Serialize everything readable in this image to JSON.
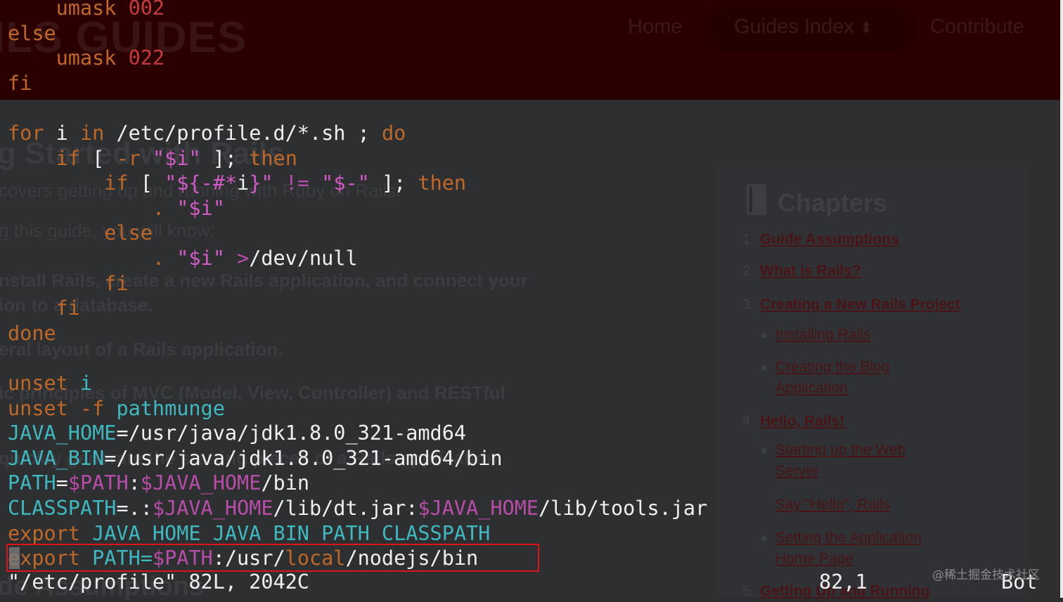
{
  "background_page": {
    "logo_text": "ILS GUIDES",
    "nav": {
      "home": "Home",
      "guides_index": "Guides Index",
      "contribute": "Contribute"
    },
    "hero": {
      "title": "g Started with Rails",
      "line1": "covers getting up and running with Ruby on Rails.",
      "line2": "g this guide, you will know:",
      "line3": "nstall Rails, create a new Rails application, and connect your",
      "line4": "ion to a database.",
      "line5": "eral layout of a Rails application.",
      "line6": "ic principles of MVC (Model, View, Controller) and RESTful",
      "line7": "quickly generate the starting pieces of a Rails application.",
      "footer_heading": "de Assumptions"
    },
    "sidebar": {
      "heading": "Chapters",
      "items": [
        {
          "num": "1.",
          "label": "Guide Assumptions"
        },
        {
          "num": "2.",
          "label": "What is Rails?"
        },
        {
          "num": "3.",
          "label": "Creating a New Rails Project"
        },
        {
          "num": "",
          "label": "Installing Rails"
        },
        {
          "num": "",
          "label": "Creating the Blog"
        },
        {
          "num": "",
          "label": "Application"
        },
        {
          "num": "4.",
          "label": "Hello, Rails!"
        },
        {
          "num": "",
          "label": "Starting up the Web"
        },
        {
          "num": "",
          "label": "Server"
        },
        {
          "num": "",
          "label": "Say \"Hello\", Rails"
        },
        {
          "num": "",
          "label": "Setting the Application"
        },
        {
          "num": "",
          "label": "Home Page"
        },
        {
          "num": "5.",
          "label": "Getting Up and Running"
        }
      ]
    }
  },
  "terminal": {
    "lines": [
      [
        {
          "t": "    umask ",
          "c": "kw"
        },
        {
          "t": "002",
          "c": "num"
        }
      ],
      [
        {
          "t": "else",
          "c": "kw"
        }
      ],
      [
        {
          "t": "    umask ",
          "c": "kw"
        },
        {
          "t": "022",
          "c": "num"
        }
      ],
      [
        {
          "t": "fi",
          "c": "kw"
        }
      ],
      [],
      [
        {
          "t": "for",
          "c": "kw"
        },
        {
          "t": " i ",
          "c": "pl"
        },
        {
          "t": "in",
          "c": "kw"
        },
        {
          "t": " /etc/profile.d/*.sh ; ",
          "c": "pl"
        },
        {
          "t": "do",
          "c": "kw"
        }
      ],
      [
        {
          "t": "    if",
          "c": "kw"
        },
        {
          "t": " [ ",
          "c": "pl"
        },
        {
          "t": "-r",
          "c": "kw"
        },
        {
          "t": " ",
          "c": "pl"
        },
        {
          "t": "\"$i\"",
          "c": "str"
        },
        {
          "t": " ]; ",
          "c": "pl"
        },
        {
          "t": "then",
          "c": "kw"
        }
      ],
      [
        {
          "t": "        if",
          "c": "kw"
        },
        {
          "t": " [ ",
          "c": "pl"
        },
        {
          "t": "\"${-#*",
          "c": "str"
        },
        {
          "t": "i",
          "c": "pl"
        },
        {
          "t": "}\"",
          "c": "str"
        },
        {
          "t": " != ",
          "c": "sp"
        },
        {
          "t": "\"$-\"",
          "c": "str"
        },
        {
          "t": " ]; ",
          "c": "pl"
        },
        {
          "t": "then",
          "c": "kw"
        }
      ],
      [
        {
          "t": "            . ",
          "c": "kw"
        },
        {
          "t": "\"$i\"",
          "c": "str"
        }
      ],
      [
        {
          "t": "        else",
          "c": "kw"
        }
      ],
      [
        {
          "t": "            . ",
          "c": "kw"
        },
        {
          "t": "\"$i\"",
          "c": "str"
        },
        {
          "t": " >",
          "c": "sp"
        },
        {
          "t": "/dev/null",
          "c": "pl"
        }
      ],
      [
        {
          "t": "        fi",
          "c": "kw"
        }
      ],
      [
        {
          "t": "    fi",
          "c": "kw"
        }
      ],
      [
        {
          "t": "done",
          "c": "kw"
        }
      ],
      [],
      [
        {
          "t": "unset",
          "c": "kw"
        },
        {
          "t": " i",
          "c": "var"
        }
      ],
      [
        {
          "t": "unset",
          "c": "kw"
        },
        {
          "t": " -f ",
          "c": "kw"
        },
        {
          "t": "pathmunge",
          "c": "var"
        }
      ],
      [
        {
          "t": "JAVA_HOME",
          "c": "var"
        },
        {
          "t": "=/usr/java/jdk1.8.0_321-amd64",
          "c": "pl"
        }
      ],
      [
        {
          "t": "JAVA_BIN",
          "c": "var"
        },
        {
          "t": "=/usr/java/jdk1.8.0_321-amd64/bin",
          "c": "pl"
        }
      ],
      [
        {
          "t": "PATH",
          "c": "var"
        },
        {
          "t": "=",
          "c": "pl"
        },
        {
          "t": "$PATH",
          "c": "sp"
        },
        {
          "t": ":",
          "c": "pl"
        },
        {
          "t": "$JAVA_HOME",
          "c": "sp"
        },
        {
          "t": "/bin",
          "c": "pl"
        }
      ],
      [
        {
          "t": "CLASSPATH",
          "c": "var"
        },
        {
          "t": "=.:",
          "c": "pl"
        },
        {
          "t": "$JAVA_HOME",
          "c": "sp"
        },
        {
          "t": "/lib/dt.jar:",
          "c": "pl"
        },
        {
          "t": "$JAVA_HOME",
          "c": "sp"
        },
        {
          "t": "/lib/tools.jar",
          "c": "pl"
        }
      ],
      [
        {
          "t": "export",
          "c": "kw"
        },
        {
          "t": " JAVA_HOME JAVA_BIN PATH CLASSPATH",
          "c": "var"
        }
      ],
      [
        {
          "t": "export",
          "c": "kw"
        },
        {
          "t": " PATH=",
          "c": "var"
        },
        {
          "t": "$PATH",
          "c": "sp"
        },
        {
          "t": ":/usr/",
          "c": "pl"
        },
        {
          "t": "local",
          "c": "kw"
        },
        {
          "t": "/nodejs/bin",
          "c": "pl"
        }
      ]
    ],
    "status": {
      "file": "\"/etc/profile\" 82L, 2042C",
      "position": "82,1",
      "scroll": "Bot"
    }
  },
  "watermark": "@稀土掘金技术社区",
  "colors": {
    "keyword": "#c06828",
    "string": "#d25bc8",
    "variable": "#3fb9c0",
    "highlight_box": "#e0131a"
  }
}
